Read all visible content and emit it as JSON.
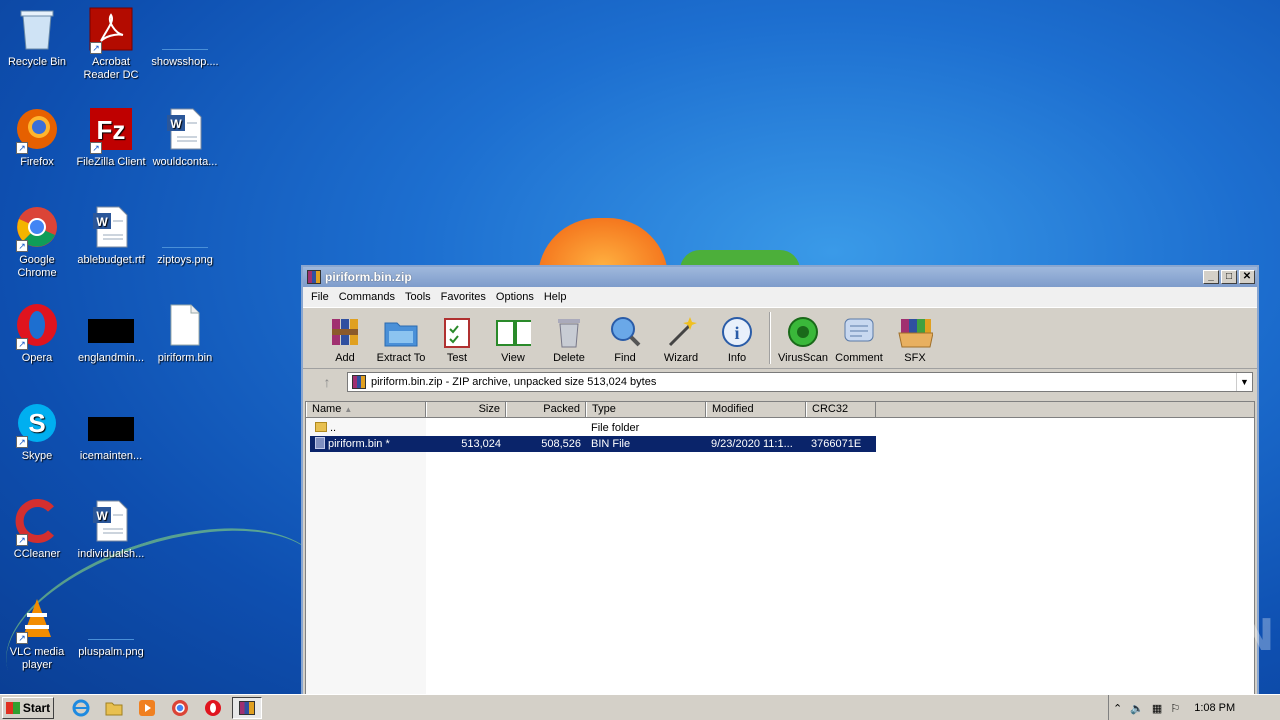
{
  "desktop": {
    "icons": [
      {
        "label": "Recycle Bin",
        "icon": "recycle-bin-icon"
      },
      {
        "label": "Acrobat Reader DC",
        "icon": "acrobat-icon"
      },
      {
        "label": "showsshop....",
        "icon": "image-thumb-icon"
      },
      {
        "label": "Firefox",
        "icon": "firefox-icon"
      },
      {
        "label": "FileZilla Client",
        "icon": "filezilla-icon"
      },
      {
        "label": "wouldconta...",
        "icon": "word-doc-icon"
      },
      {
        "label": "Google Chrome",
        "icon": "chrome-icon"
      },
      {
        "label": "ablebudget.rtf",
        "icon": "word-doc-icon"
      },
      {
        "label": "ziptoys.png",
        "icon": "image-thumb-icon"
      },
      {
        "label": "Opera",
        "icon": "opera-icon"
      },
      {
        "label": "englandmin...",
        "icon": "black-thumb-icon"
      },
      {
        "label": "piriform.bin",
        "icon": "blank-file-icon"
      },
      {
        "label": "Skype",
        "icon": "skype-icon"
      },
      {
        "label": "icemainten...",
        "icon": "black-thumb-icon"
      },
      {
        "label": "CCleaner",
        "icon": "ccleaner-icon"
      },
      {
        "label": "individualsh...",
        "icon": "word-doc-icon"
      },
      {
        "label": "VLC media player",
        "icon": "vlc-icon"
      },
      {
        "label": "pluspalm.png",
        "icon": "image-thumb-icon"
      }
    ]
  },
  "window": {
    "title": "piriform.bin.zip",
    "controls": {
      "minimize": "_",
      "maximize": "□",
      "close": "✕"
    },
    "menu": [
      "File",
      "Commands",
      "Tools",
      "Favorites",
      "Options",
      "Help"
    ],
    "toolbar": [
      {
        "label": "Add",
        "icon": "add-archive-icon"
      },
      {
        "label": "Extract To",
        "icon": "extract-folder-icon"
      },
      {
        "label": "Test",
        "icon": "test-clipboard-icon"
      },
      {
        "label": "View",
        "icon": "view-book-icon"
      },
      {
        "label": "Delete",
        "icon": "trash-icon"
      },
      {
        "label": "Find",
        "icon": "magnifier-icon"
      },
      {
        "label": "Wizard",
        "icon": "wand-icon"
      },
      {
        "label": "Info",
        "icon": "info-icon"
      },
      {
        "label": "VirusScan",
        "icon": "virus-scan-icon"
      },
      {
        "label": "Comment",
        "icon": "comment-icon"
      },
      {
        "label": "SFX",
        "icon": "sfx-box-icon"
      }
    ],
    "address": "piriform.bin.zip - ZIP archive, unpacked size 513,024 bytes",
    "columns": [
      "Name",
      "Size",
      "Packed",
      "Type",
      "Modified",
      "CRC32"
    ],
    "rows": [
      {
        "name": "..",
        "size": "",
        "packed": "",
        "type": "File folder",
        "modified": "",
        "crc": ""
      },
      {
        "name": "piriform.bin *",
        "size": "513,024",
        "packed": "508,526",
        "type": "BIN File",
        "modified": "9/23/2020 11:1...",
        "crc": "3766071E"
      }
    ]
  },
  "taskbar": {
    "start_label": "Start",
    "clock": "1:08 PM"
  },
  "watermark": "ANY RUN"
}
